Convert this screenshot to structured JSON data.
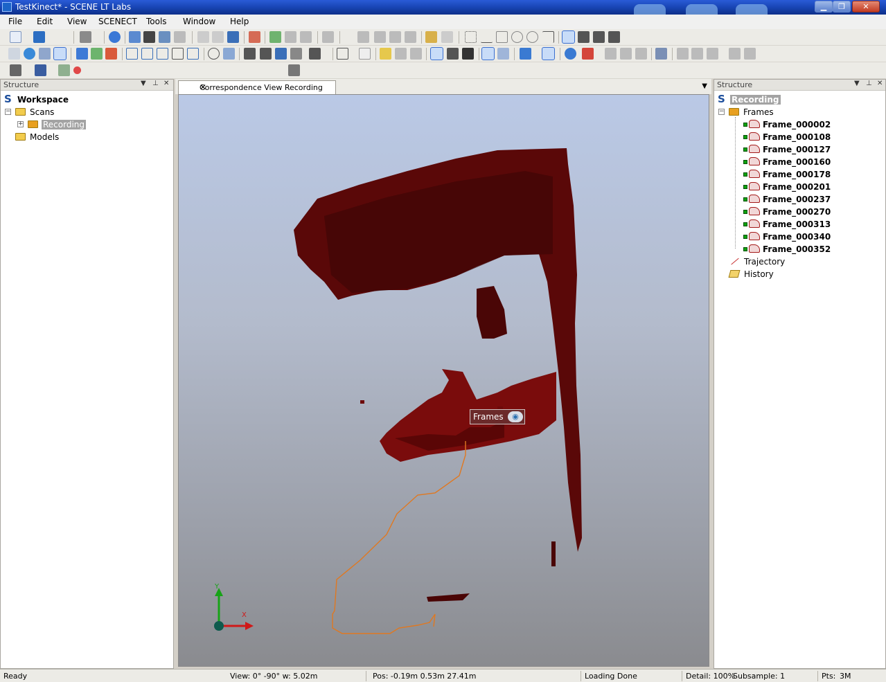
{
  "window": {
    "title": "TestKinect* - SCENE LT Labs"
  },
  "menu": [
    "File",
    "Edit",
    "View",
    "SCENECT",
    "Tools",
    "Window",
    "Help"
  ],
  "left_panel": {
    "header": "Structure",
    "tree": {
      "workspace": "Workspace",
      "scans": "Scans",
      "recording": "Recording",
      "models": "Models"
    }
  },
  "view_tab": {
    "label": "Correspondence View Recording",
    "close": "✕"
  },
  "viewport": {
    "label": "Frames",
    "axis_y": "Y",
    "axis_x": "X",
    "colors": {
      "cloud": "#6e0a0a",
      "trajectory": "#e07820"
    }
  },
  "right_panel": {
    "header": "Structure",
    "root": "Recording",
    "frames_label": "Frames",
    "frames": [
      "Frame_000002",
      "Frame_000108",
      "Frame_000127",
      "Frame_000160",
      "Frame_000178",
      "Frame_000201",
      "Frame_000237",
      "Frame_000270",
      "Frame_000313",
      "Frame_000340",
      "Frame_000352"
    ],
    "trajectory": "Trajectory",
    "history": "History"
  },
  "status": {
    "ready": "Ready",
    "view": "View: 0° -90° w: 5.02m",
    "pos": "Pos: -0.19m 0.53m 27.41m",
    "loading": "Loading Done",
    "detail": "Detail: 100%",
    "subsample": "Subsample:  1",
    "pts": "Pts:",
    "pts_value": "3M"
  }
}
